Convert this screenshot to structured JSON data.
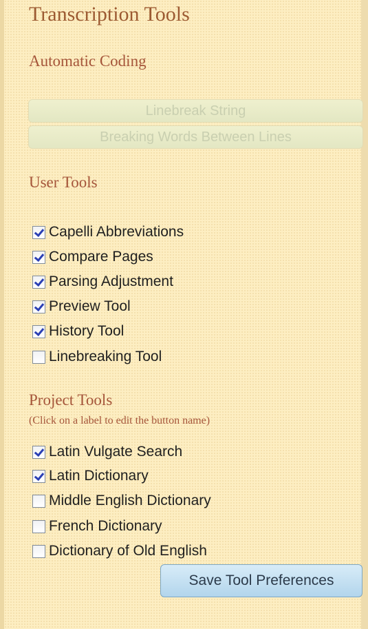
{
  "title": "Transcription Tools",
  "automatic_coding": {
    "heading": "Automatic Coding",
    "buttons": [
      "Linebreak String",
      "Breaking Words Between Lines"
    ]
  },
  "user_tools": {
    "heading": "User Tools",
    "items": [
      {
        "label": "Capelli Abbreviations",
        "checked": true
      },
      {
        "label": "Compare Pages",
        "checked": true
      },
      {
        "label": "Parsing Adjustment",
        "checked": true
      },
      {
        "label": "Preview Tool",
        "checked": true
      },
      {
        "label": "History Tool",
        "checked": true
      },
      {
        "label": "Linebreaking Tool",
        "checked": false
      }
    ]
  },
  "project_tools": {
    "heading": "Project Tools",
    "hint": "(Click on a label to edit the button name)",
    "items": [
      {
        "label": "Latin Vulgate Search",
        "checked": true
      },
      {
        "label": "Latin Dictionary",
        "checked": true
      },
      {
        "label": "Middle English Dictionary",
        "checked": false
      },
      {
        "label": "French Dictionary",
        "checked": false
      },
      {
        "label": "Dictionary of Old English",
        "checked": false
      }
    ]
  },
  "save_button": "Save Tool Preferences"
}
